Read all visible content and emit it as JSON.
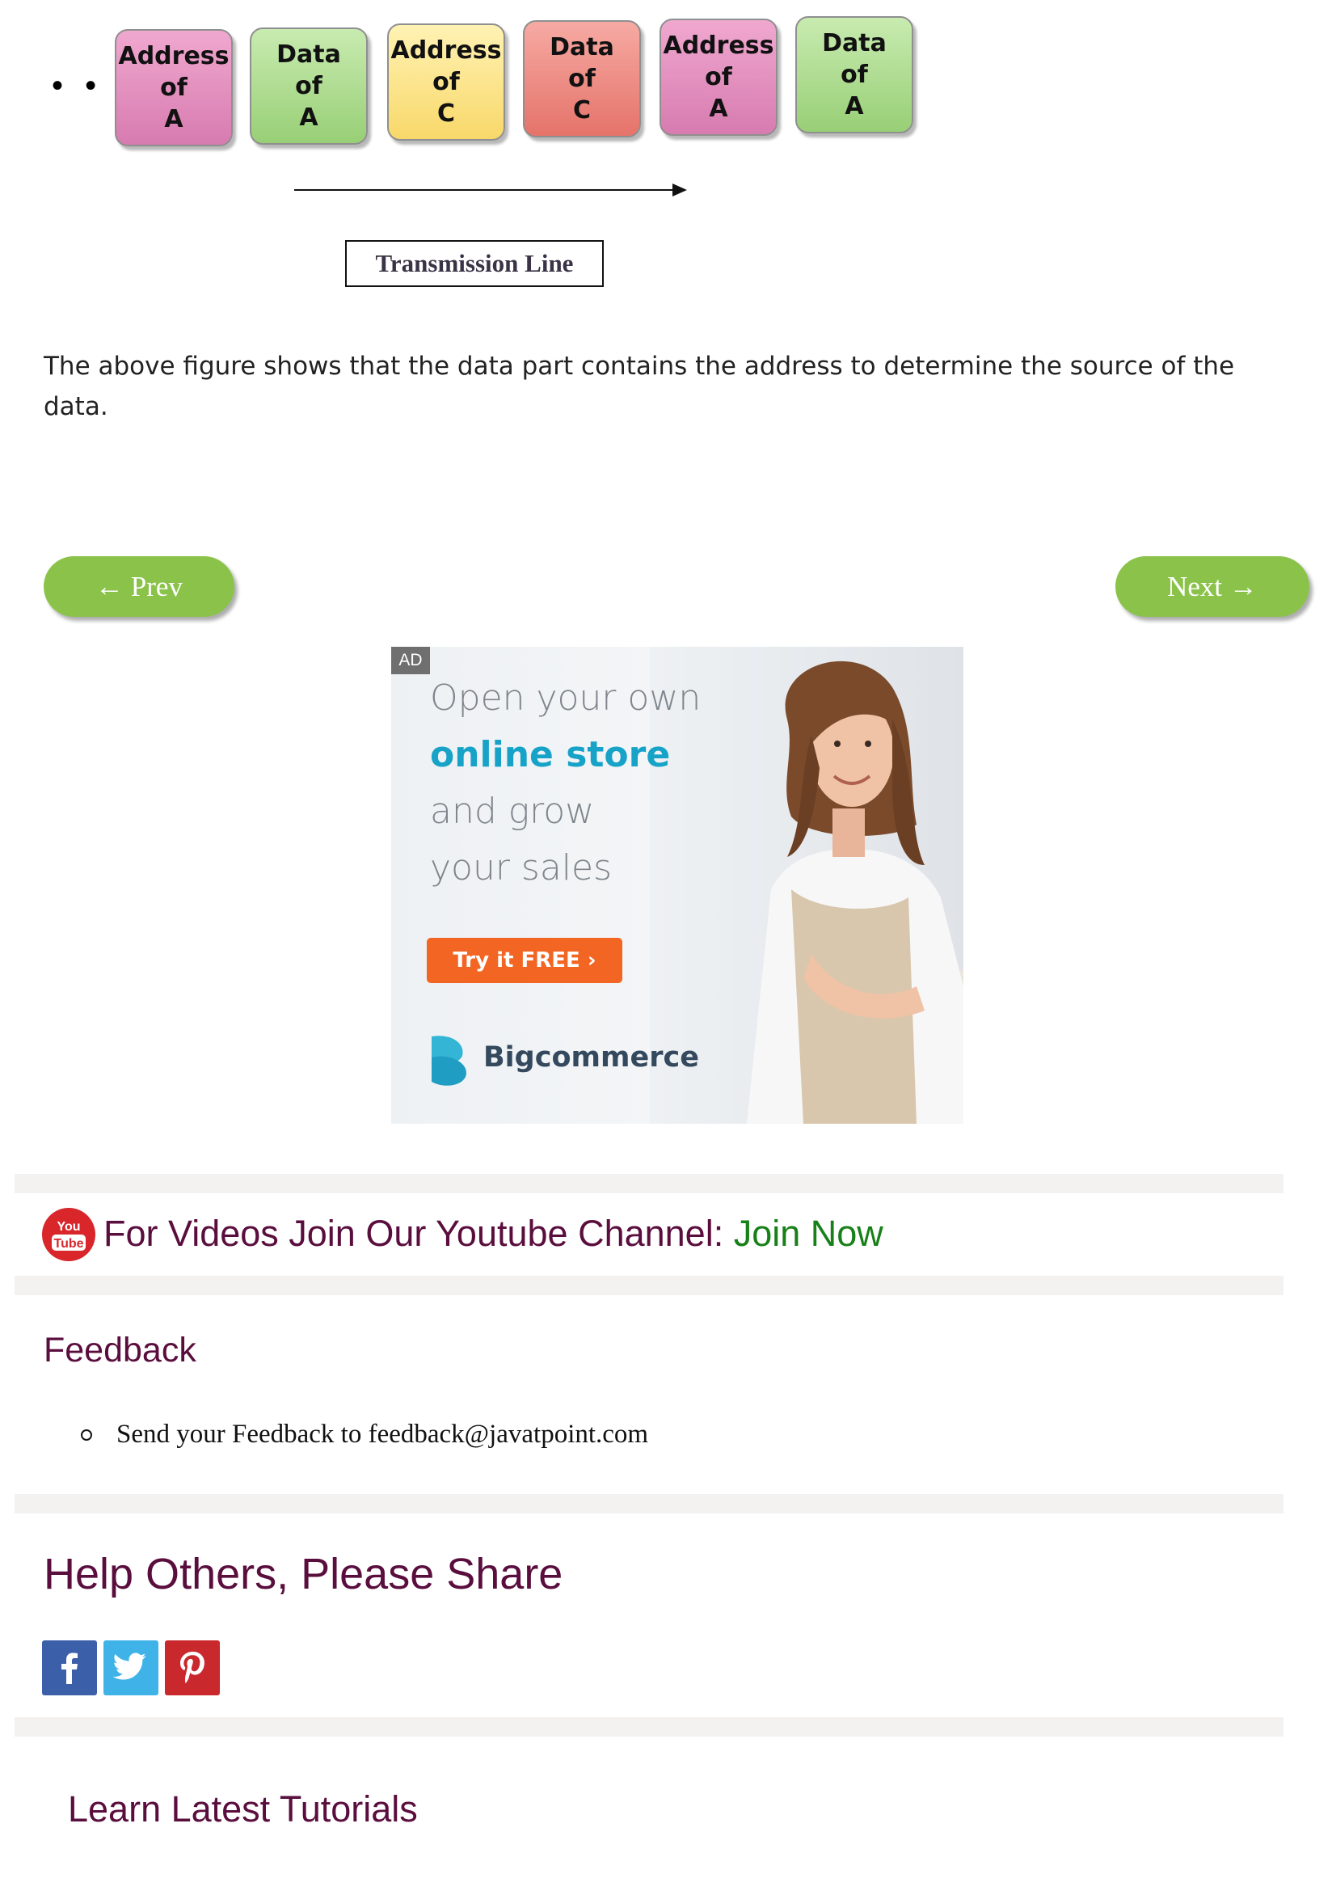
{
  "diagram": {
    "frames": [
      {
        "line1": "Address",
        "line2": "of",
        "line3": "A",
        "color": "#e08cbd"
      },
      {
        "line1": "Data",
        "line2": "of",
        "line3": "A",
        "color": "#a8d98a"
      },
      {
        "line1": "Address",
        "line2": "of",
        "line3": "C",
        "color": "#fbe38a"
      },
      {
        "line1": "Data",
        "line2": "of",
        "line3": "C",
        "color": "#ec8a82"
      },
      {
        "line1": "Address",
        "line2": "of",
        "line3": "A",
        "color": "#e08cbd"
      },
      {
        "line1": "Data",
        "line2": "of",
        "line3": "A",
        "color": "#a8d98a"
      }
    ],
    "leading_dots": "• •",
    "label": "Transmission Line"
  },
  "paragraph": "The above figure shows that the data part contains the address to determine the source of the data.",
  "nav": {
    "prev_label": "← Prev",
    "next_label": "Next →",
    "color": "#8bc34a"
  },
  "ad": {
    "badge": "AD",
    "line1": "Open your own",
    "line2": "online store",
    "line3": "and grow",
    "line4": "your sales",
    "cta": "Try it FREE ›",
    "brand": "Bigcommerce"
  },
  "youtube": {
    "icon_top": "You",
    "icon_bottom": "Tube",
    "text": "For Videos Join Our Youtube Channel: ",
    "link": "Join Now"
  },
  "feedback": {
    "heading": "Feedback",
    "item": "Send your Feedback to feedback@javatpoint.com"
  },
  "share": {
    "heading": "Help Others, Please Share",
    "icons": [
      "facebook-icon",
      "twitter-icon",
      "pinterest-icon"
    ]
  },
  "learn": {
    "heading": "Learn Latest Tutorials"
  },
  "colors": {
    "heading": "#5a0e3d",
    "link_green": "#188018",
    "divider": "#f4f1f1"
  }
}
